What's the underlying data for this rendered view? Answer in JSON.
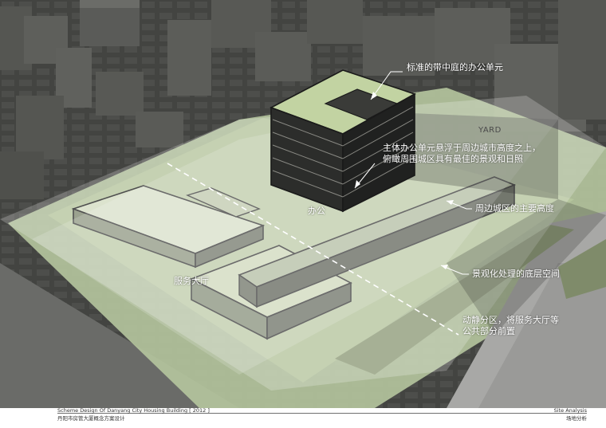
{
  "annotations": {
    "courtyard_unit": "标准的带中庭的办公单元",
    "floating_unit_line1": "主体办公单元悬浮于周边城市高度之上，",
    "floating_unit_line2": "俯瞰周围城区具有最佳的景观和日照",
    "yard": "YARD",
    "office": "办公",
    "city_height": "周边城区的主要高度",
    "service_hall": "服务大厅",
    "landscaped_ground": "景观化处理的底层空间",
    "zoning_line1": "动静分区，将服务大厅等",
    "zoning_line2": "公共部分前置"
  },
  "footer": {
    "project_en": "Scheme Design Of Danyang City Housing Building [ 2012 ]",
    "project_cn": "丹阳市房管大厦概念方案设计",
    "section_en": "Site Analysis",
    "section_cn": "场地分析"
  },
  "colors": {
    "ground": "#3c3d3a",
    "site_green": "#b8c8a0",
    "roof_green": "#c4d4a8",
    "glass_overlay": "#ffffff",
    "facade_dark": "#303132",
    "road_light": "#9c9c9c"
  }
}
